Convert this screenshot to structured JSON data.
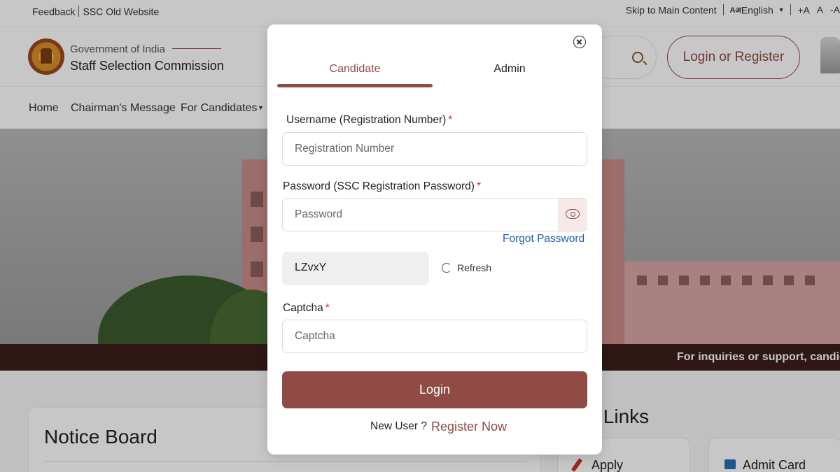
{
  "topbar": {
    "feedback": "Feedback",
    "old_website": "SSC Old Website",
    "skip": "Skip to Main Content",
    "lang_icon": "Aअ",
    "language": "English",
    "font_increase": "+A",
    "font_normal": "A",
    "font_decrease": "-A"
  },
  "header": {
    "gov": "Government of India",
    "org": "Staff Selection Commission",
    "login_register": "Login or Register"
  },
  "nav": {
    "home": "Home",
    "chairman": "Chairman's Message",
    "candidates": "For Candidates"
  },
  "ticker": {
    "text": "For inquiries or support, candida"
  },
  "notice_board": {
    "title": "Notice Board"
  },
  "quick_links": {
    "title": "k Links",
    "apply": "Apply",
    "admit_card": "Admit Card"
  },
  "modal": {
    "tabs": {
      "candidate": "Candidate",
      "admin": "Admin"
    },
    "username": {
      "label": "Username (Registration Number)",
      "required": "*",
      "placeholder": "Registration Number"
    },
    "password": {
      "label": "Password (SSC Registration Password)",
      "required": "*",
      "placeholder": "Password"
    },
    "forgot_password": "Forgot Password",
    "captcha_code": "LZvxY",
    "refresh": "Refresh",
    "captcha": {
      "label": "Captcha",
      "required": "*",
      "placeholder": "Captcha"
    },
    "login": "Login",
    "new_user": "New User ?",
    "register_now": "Register Now"
  },
  "colors": {
    "brand": "#8f4b44",
    "link": "#1f5fa8",
    "ticker_bg": "#3c1e1c"
  }
}
